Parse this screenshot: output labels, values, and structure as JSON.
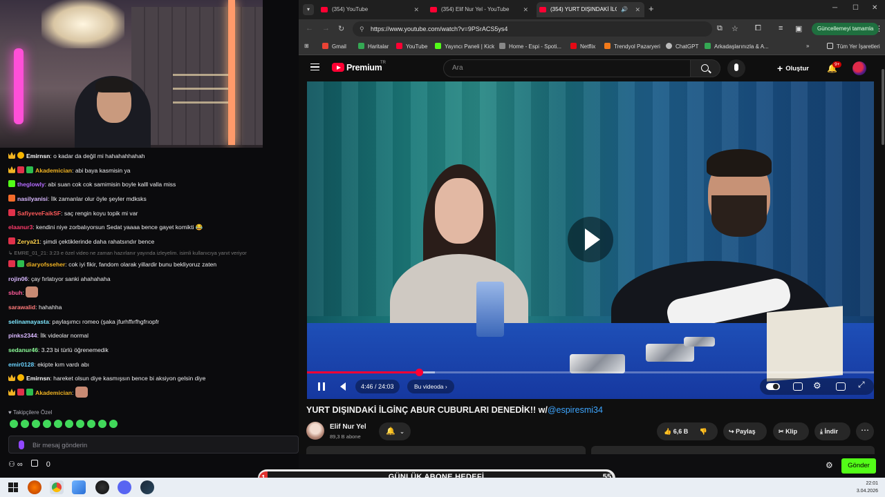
{
  "browser": {
    "tabs": [
      {
        "label": "(354) YouTube",
        "active": false
      },
      {
        "label": "(354) Elif Nur Yel - YouTube",
        "active": false
      },
      {
        "label": "(354) YURT DIŞINDAKİ İLGİN",
        "active": true
      }
    ],
    "url": "https://www.youtube.com/watch?v=9PSrACS5ys4",
    "update_button": "Güncellemeyi tamamla",
    "bookmarks": [
      "Gmail",
      "Haritalar",
      "YouTube",
      "Yayıncı Paneli | Kick",
      "Home - Espi - Spoti...",
      "Netflix",
      "Trendyol Pazaryeri",
      "ChatGPT",
      "Arkadaşlarınızla & A..."
    ],
    "bookmarks_all": "Tüm Yer İşaretleri"
  },
  "youtube": {
    "brand": "Premium",
    "region": "TR",
    "search_placeholder": "Ara",
    "create_label": "Oluştur",
    "notif_badge": "9+",
    "player": {
      "time": "4:46 / 24:03",
      "chapter": "Bu videoda",
      "progress": {
        "played_fraction": 0.198,
        "loaded_fraction": 0.225
      }
    },
    "video_title": "YURT DIŞINDAKİ İLGİNÇ ABUR CUBURLARI DENEDİK!! w/",
    "video_mention": "@espiresmi34",
    "channel_name": "Elif Nur Yel",
    "channel_subs": "89,3 B abone",
    "likes": "6,6 B",
    "share": "Paylaş",
    "clip": "Klip",
    "download": "İndir"
  },
  "chat": {
    "messages": [
      {
        "user": "Emirnsn",
        "color": "#ffffff",
        "badges": [
          "crown",
          "coin"
        ],
        "text": "o kadar da değil mi hahahahhahah"
      },
      {
        "user": "Akademician",
        "color": "#f0b323",
        "badges": [
          "crown",
          "red",
          "gift"
        ],
        "text": "abi baya kasmisin ya"
      },
      {
        "user": "theglowly",
        "color": "#b46bff",
        "badges": [
          "green"
        ],
        "text": "abi suan cok cok samimisin boyle kalll valla miss"
      },
      {
        "user": "nasilyanisi",
        "color": "#d9b8ff",
        "badges": [
          "orange"
        ],
        "text": "İlk zamanlar olur öyle şeyler mdksks"
      },
      {
        "user": "SafiyeveFaikSF",
        "color": "#ff5a5a",
        "badges": [
          "red"
        ],
        "text": "saç rengin koyu topik mi var"
      },
      {
        "user": "elaanur3",
        "color": "#ff3b6b",
        "badges": [],
        "text": "kendini niye zorbalıyorsun Sedat yaaaa bence gayet komikti 😂"
      },
      {
        "user": "Zerya21",
        "color": "#ffd24a",
        "badges": [
          "red"
        ],
        "text": "şimdi çektiklerinde daha rahatsındır bence"
      },
      {
        "reply": "↳ EMRE_01_21: 3:23 e özel video ne zaman hazırlanır yayında izleyelim. isimli kullanıcıya yanıt veriyor"
      },
      {
        "user": "diaryofsseher",
        "color": "#f0b323",
        "badges": [
          "red",
          "gift"
        ],
        "text": "cok iyi fikir, fandom olarak yillardir bunu bekliyoruz zaten"
      },
      {
        "user": "rojin06",
        "color": "#d9b8ff",
        "badges": [],
        "text": "çay fırlatıyor sanki ahahahaha"
      },
      {
        "user": "sbuh",
        "color": "#ff5a9a",
        "badges": [],
        "text": "",
        "emote": true
      },
      {
        "user": "sarawalid",
        "color": "#ff7a7a",
        "badges": [],
        "text": "hahahha"
      },
      {
        "user": "selinamayasta",
        "color": "#7ee7ff",
        "badges": [],
        "text": "paylaşımcı romeo (şaka jfurhffırfhgfrıopfr"
      },
      {
        "user": "pinks2344",
        "color": "#d9b8ff",
        "badges": [],
        "text": "İlk videolar normal"
      },
      {
        "user": "sedanur46",
        "color": "#8dff9a",
        "badges": [],
        "text": "3.23 bi türlü öğrenemedik"
      },
      {
        "user": "emir0128",
        "color": "#6ad2ff",
        "badges": [],
        "text": "ekipte kım vardı abı"
      },
      {
        "user": "Emirnsn",
        "color": "#ffffff",
        "badges": [
          "crown",
          "coin"
        ],
        "text": "hareket olsun diye kasmışsın bence bi aksiyon gelsin diye"
      },
      {
        "user": "Akademician",
        "color": "#f0b323",
        "badges": [
          "crown",
          "red",
          "gift"
        ],
        "text": "",
        "emote": true
      }
    ],
    "followers_only": "♥ Takipçilere Özel",
    "input_placeholder": "Bir mesaj gönderin",
    "viewers_icon": "infinity-icon",
    "counter": "0",
    "send_label": "Gönder"
  },
  "goal": {
    "label": "GÜNLÜK ABONE HEDEFİ",
    "current": "1",
    "target": "55"
  },
  "taskbar": {
    "time": "22:01",
    "date": "3.04.2026"
  }
}
